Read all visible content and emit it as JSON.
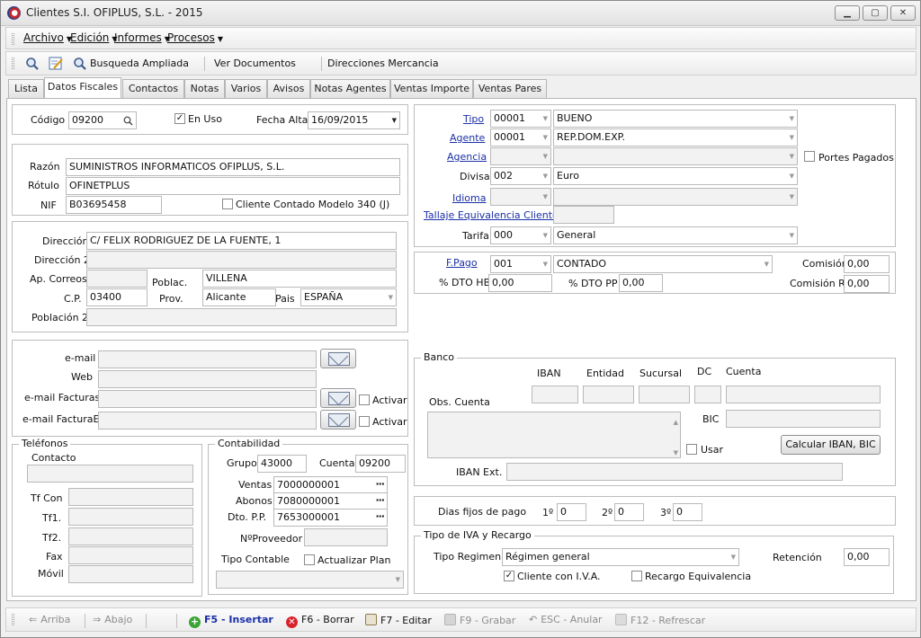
{
  "window": {
    "title": "Clientes  S.I. OFIPLUS, S.L. - 2015",
    "min": "▁",
    "max": "▢",
    "close": "✕"
  },
  "menu": {
    "items": [
      "Archivo",
      "Edición",
      "Informes",
      "Procesos"
    ]
  },
  "toolbar": {
    "search_icon": "search-icon",
    "edit_icon": "edit-icon",
    "busqueda": "Busqueda Ampliada",
    "ver_docs": "Ver Documentos",
    "direcciones": "Direcciones Mercancia"
  },
  "tabs": [
    "Lista",
    "Datos Fiscales",
    "Contactos",
    "Notas",
    "Varios",
    "Avisos",
    "Notas Agentes",
    "Ventas Importe",
    "Ventas Pares"
  ],
  "active_tab": "Datos Fiscales",
  "header": {
    "codigo_label": "Código",
    "codigo": "09200",
    "en_uso_label": "En Uso",
    "en_uso": true,
    "fecha_alta_label": "Fecha Alta",
    "fecha_alta": "16/09/2015"
  },
  "identity": {
    "razon_label": "Razón",
    "razon": "SUMINISTROS INFORMATICOS OFIPLUS, S.L.",
    "rotulo_label": "Rótulo",
    "rotulo": "OFINETPLUS",
    "nif_label": "NIF",
    "nif": "B03695458",
    "contado_label": "Cliente Contado Modelo 340 (J)"
  },
  "address": {
    "direccion_label": "Dirección",
    "direccion": "C/ FELIX RODRIGUEZ DE LA FUENTE, 1",
    "direccion2_label": "Dirección 2",
    "direccion2": "",
    "apcorreos_label": "Ap. Correos",
    "apcorreos": "",
    "poblac_label": "Poblac.",
    "poblac": "VILLENA",
    "cp_label": "C.P.",
    "cp": "03400",
    "prov_label": "Prov.",
    "prov": "Alicante",
    "pais_label": "Pais",
    "pais": "ESPAÑA",
    "poblacion2_label": "Población 2",
    "poblacion2": ""
  },
  "contact": {
    "email_label": "e-mail",
    "web_label": "Web",
    "email_facturas_label": "e-mail Facturas",
    "email_facturae_label": "e-mail FacturaE",
    "activar_label": "Activar"
  },
  "telefonos": {
    "legend": "Teléfonos",
    "contacto_label": "Contacto",
    "tfcon_label": "Tf Con",
    "tf1_label": "Tf1.",
    "tf2_label": "Tf2.",
    "fax_label": "Fax",
    "movil_label": "Móvil"
  },
  "contabilidad": {
    "legend": "Contabilidad",
    "grupo_label": "Grupo",
    "grupo": "43000",
    "cuenta_label": "Cuenta",
    "cuenta": "09200",
    "ventas_label": "Ventas",
    "ventas": "7000000001",
    "abonos_label": "Abonos",
    "abonos": "7080000001",
    "dtopp_label": "Dto. P.P.",
    "dtopp": "7653000001",
    "nproveedor_label": "NºProveedor",
    "tipo_contable_label": "Tipo Contable",
    "actualizar_label": "Actualizar Plan",
    "ellipsis": "···"
  },
  "commercial": {
    "tipo_label": "Tipo",
    "tipo_code": "00001",
    "tipo_name": "BUENO",
    "agente_label": "Agente",
    "agente_code": "00001",
    "agente_name": "REP.DOM.EXP.",
    "agencia_label": "Agencia",
    "portes_label": "Portes Pagados",
    "divisa_label": "Divisa",
    "divisa_code": "002",
    "divisa_name": "Euro",
    "idioma_label": "Idioma",
    "tallaje_label": "Tallaje Equivalencia Cliente",
    "tarifa_label": "Tarifa",
    "tarifa_code": "000",
    "tarifa_name": "General"
  },
  "payment": {
    "fpago_label": "F.Pago",
    "fpago_code": "001",
    "fpago_name": "CONTADO",
    "comision_label": "Comisión",
    "comision": "0,00",
    "dtohb_label": "% DTO HB",
    "dtohb": "0,00",
    "dtopp_label": "% DTO PP",
    "dtopp": "0,00",
    "comisionr_label": "Comisión R.",
    "comisionr": "0,00"
  },
  "banco": {
    "legend": "Banco",
    "iban_label": "IBAN",
    "entidad_label": "Entidad",
    "sucursal_label": "Sucursal",
    "dc_label": "DC",
    "cuenta_label": "Cuenta",
    "obs_label": "Obs. Cuenta",
    "bic_label": "BIC",
    "usar_label": "Usar",
    "calcular_label": "Calcular IBAN, BIC",
    "ibanext_label": "IBAN Ext."
  },
  "dias": {
    "label": "Dias fijos de pago",
    "d1_label": "1º",
    "d1": "0",
    "d2_label": "2º",
    "d2": "0",
    "d3_label": "3º",
    "d3": "0"
  },
  "iva": {
    "legend": "Tipo de IVA y Recargo",
    "regimen_label": "Tipo Regimen",
    "regimen": "Régimen general",
    "retencion_label": "Retención",
    "retencion": "0,00",
    "cliente_iva_label": "Cliente con I.V.A.",
    "cliente_iva": true,
    "recargo_label": "Recargo Equivalencia",
    "recargo": false
  },
  "statusbar": {
    "arriba": "Arriba",
    "abajo": "Abajo",
    "insertar": "F5 - Insertar",
    "borrar": "F6 - Borrar",
    "editar": "F7 - Editar",
    "grabar": "F9 - Grabar",
    "anular": "ESC - Anular",
    "refrescar": "F12 - Refrescar"
  },
  "colors": {
    "link": "#1a2fa8",
    "insert": "#1a2fa8",
    "delete_icon": "#d8232a",
    "insert_icon": "#3aa335"
  }
}
